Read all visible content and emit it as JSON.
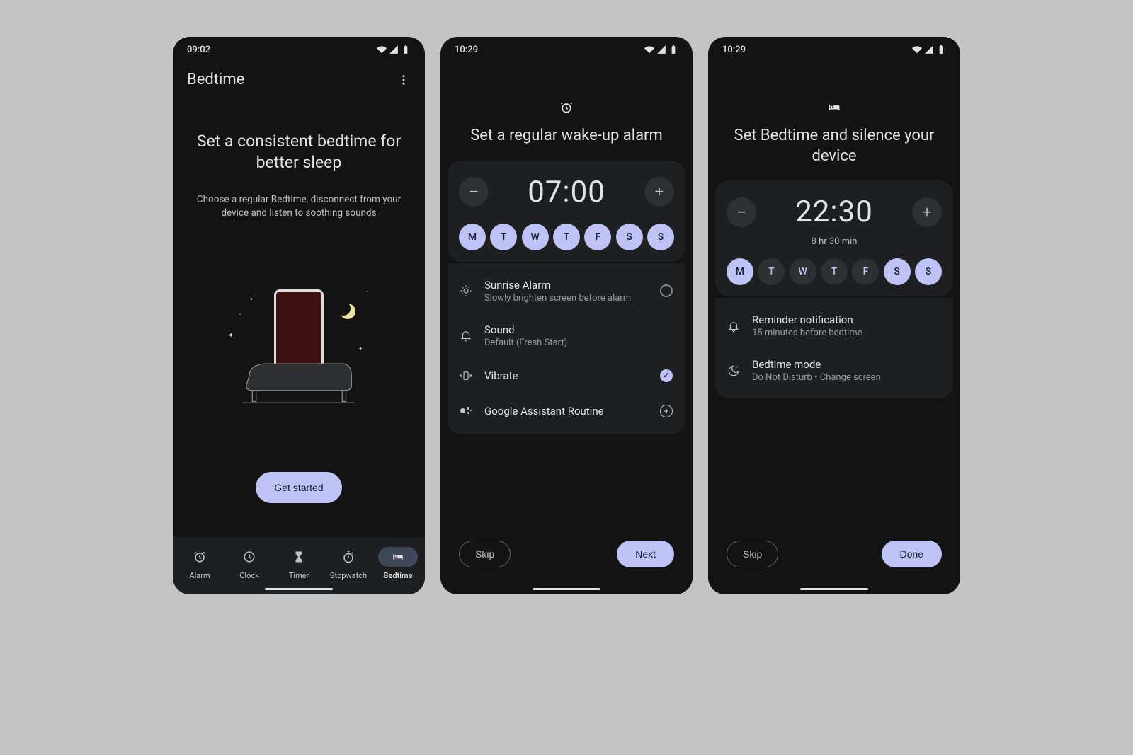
{
  "screen1": {
    "status_time": "09:02",
    "header": "Bedtime",
    "hero_title": "Set a consistent bedtime for better sleep",
    "hero_sub": "Choose a regular Bedtime, disconnect from your device and listen to soothing sounds",
    "cta": "Get started",
    "nav": [
      {
        "label": "Alarm"
      },
      {
        "label": "Clock"
      },
      {
        "label": "Timer"
      },
      {
        "label": "Stopwatch"
      },
      {
        "label": "Bedtime"
      }
    ]
  },
  "screen2": {
    "status_time": "10:29",
    "title": "Set a regular wake-up alarm",
    "time": "07:00",
    "days": [
      "M",
      "T",
      "W",
      "T",
      "F",
      "S",
      "S"
    ],
    "active_days": [
      true,
      true,
      true,
      true,
      true,
      true,
      true
    ],
    "options": [
      {
        "title": "Sunrise Alarm",
        "sub": "Slowly brighten screen before alarm"
      },
      {
        "title": "Sound",
        "sub": "Default (Fresh Start)"
      },
      {
        "title": "Vibrate",
        "sub": ""
      },
      {
        "title": "Google Assistant Routine",
        "sub": ""
      }
    ],
    "skip": "Skip",
    "next": "Next"
  },
  "screen3": {
    "status_time": "10:29",
    "title": "Set Bedtime and silence your device",
    "time": "22:30",
    "duration": "8 hr 30 min",
    "days": [
      "M",
      "T",
      "W",
      "T",
      "F",
      "S",
      "S"
    ],
    "active_days": [
      true,
      false,
      false,
      false,
      false,
      true,
      true
    ],
    "options": [
      {
        "title": "Reminder notification",
        "sub": "15 minutes before bedtime"
      },
      {
        "title": "Bedtime mode",
        "sub": "Do Not Disturb • Change screen"
      }
    ],
    "skip": "Skip",
    "done": "Done"
  }
}
